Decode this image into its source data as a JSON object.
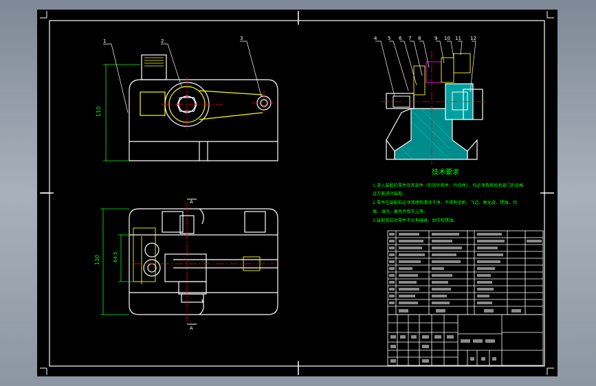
{
  "colors": {
    "background": "#000000",
    "outline": "#ffffff",
    "dimension": "#00ff00",
    "centerline": "#ff0000",
    "annotation": "#ffff00",
    "hatch": "#00c0c0",
    "part": "#ff00ff"
  },
  "balloons": {
    "front_view": [
      "1",
      "2",
      "3"
    ],
    "side_view": [
      "4",
      "5",
      "6",
      "7",
      "8",
      "9",
      "10",
      "11",
      "12"
    ]
  },
  "dimensions": {
    "front_height": "110",
    "top_height": "130",
    "top_inner": "64.5"
  },
  "section_marks": {
    "top": "A",
    "bottom": "A"
  },
  "tech_requirements": {
    "title": "技术要求",
    "lines": [
      "1.进入装配的零件及其部件（包括外购件、外协件），均必须具有检验部门的合格",
      "证方能进行装配。",
      "2.零件在装配前必须清理和清洗干净，不得有毛刺、飞边、氧化皮、锈蚀、切",
      "屑、油污、着色剂和灰尘等。",
      "3.装配前应对零件不允有磕碰、划伤和锈蚀。"
    ]
  }
}
